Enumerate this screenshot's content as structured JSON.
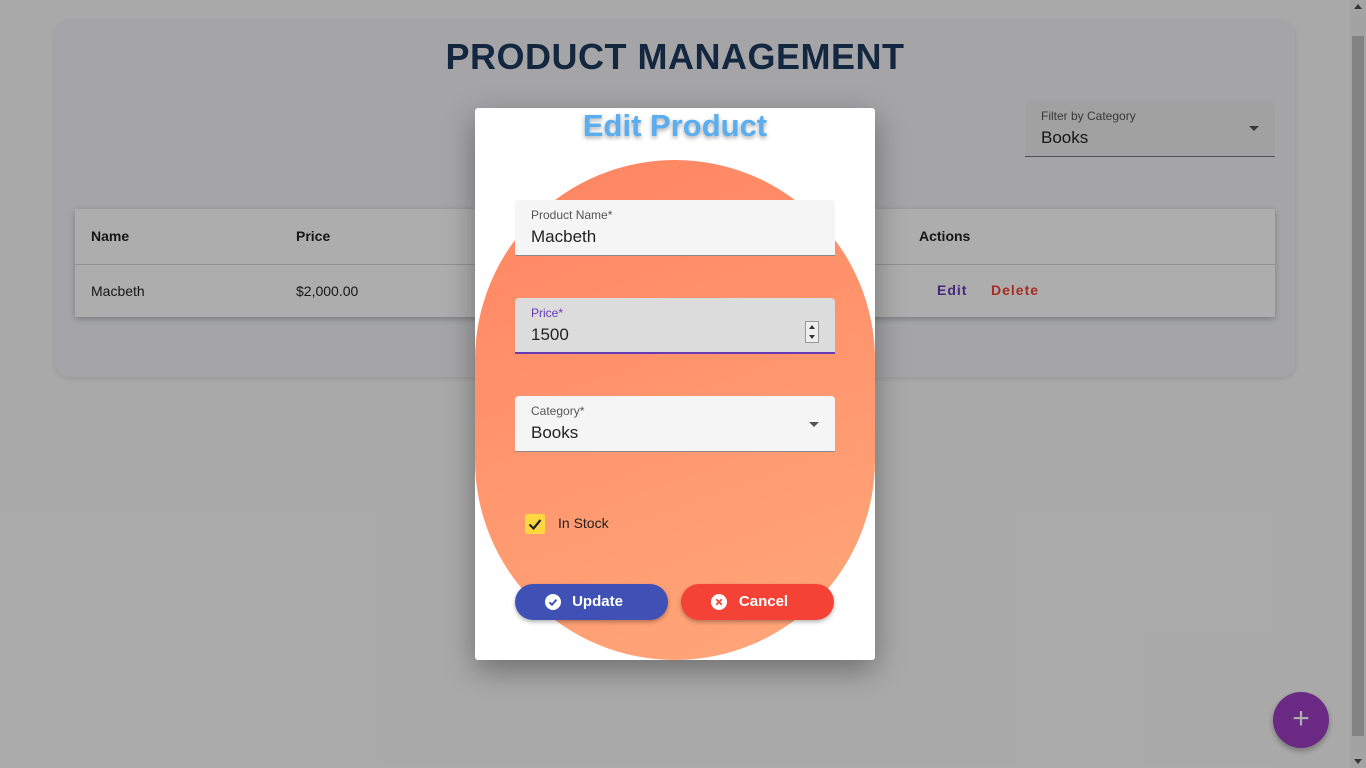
{
  "page": {
    "title": "PRODUCT MANAGEMENT",
    "filter": {
      "label": "Filter by Category",
      "value": "Books"
    },
    "table": {
      "headers": [
        "Name",
        "Price",
        "Actions"
      ],
      "rows": [
        {
          "name": "Macbeth",
          "price": "$2,000.00",
          "edit": "Edit",
          "delete": "Delete"
        }
      ]
    },
    "fab": {
      "icon": "plus-icon",
      "label": "+"
    }
  },
  "dialog": {
    "title": "Edit Product",
    "fields": {
      "product_name": {
        "label": "Product Name*",
        "value": "Macbeth"
      },
      "price": {
        "label": "Price*",
        "value": "1500"
      },
      "category": {
        "label": "Category*",
        "value": "Books"
      }
    },
    "in_stock": {
      "label": "In Stock",
      "checked": true
    },
    "buttons": {
      "update": {
        "label": "Update",
        "icon": "check-circle-icon"
      },
      "cancel": {
        "label": "Cancel",
        "icon": "x-circle-icon"
      }
    }
  },
  "colors": {
    "title": "#1e3a5f",
    "dialog_title": "#5aaef0",
    "form_gradient_start": "#ff8462",
    "form_gradient_end": "#ffa87a",
    "update": "#3f51b5",
    "cancel": "#f44336",
    "edit_action": "#673ab7",
    "delete_action": "#f44336",
    "fab": "#9c3fc1",
    "checkbox": "#ffd740"
  }
}
